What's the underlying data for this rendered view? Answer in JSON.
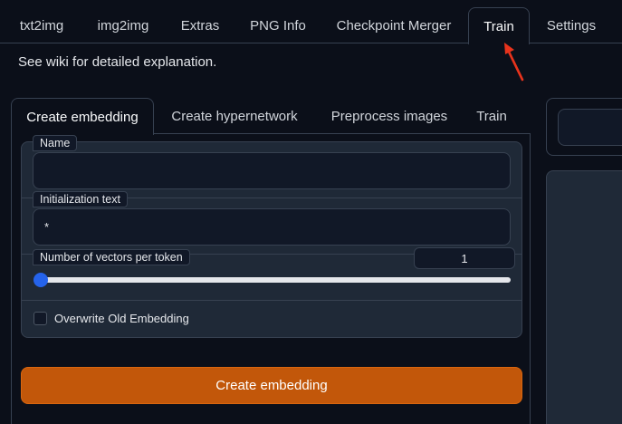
{
  "top_tabs": [
    {
      "label": "txt2img"
    },
    {
      "label": "img2img"
    },
    {
      "label": "Extras"
    },
    {
      "label": "PNG Info"
    },
    {
      "label": "Checkpoint Merger"
    },
    {
      "label": "Train",
      "active": true
    },
    {
      "label": "Settings"
    }
  ],
  "wiki_note": {
    "prefix": "See ",
    "link": "wiki",
    "suffix": " for detailed explanation."
  },
  "sub_tabs": [
    {
      "label": "Create embedding",
      "active": true
    },
    {
      "label": "Create hypernetwork"
    },
    {
      "label": "Preprocess images"
    },
    {
      "label": "Train"
    }
  ],
  "form": {
    "name": {
      "label": "Name",
      "value": ""
    },
    "init_text": {
      "label": "Initialization text",
      "value": "*"
    },
    "vectors": {
      "label": "Number of vectors per token",
      "value": "1",
      "fraction": 0.0
    },
    "overwrite": {
      "label": "Overwrite Old Embedding",
      "checked": false
    }
  },
  "create_button": {
    "label": "Create embedding"
  },
  "colors": {
    "accent_orange": "#c2570a",
    "slider_thumb": "#2563eb",
    "annotation_arrow": "#e8331c",
    "background": "#0b0f19",
    "panel": "#1f2937"
  }
}
